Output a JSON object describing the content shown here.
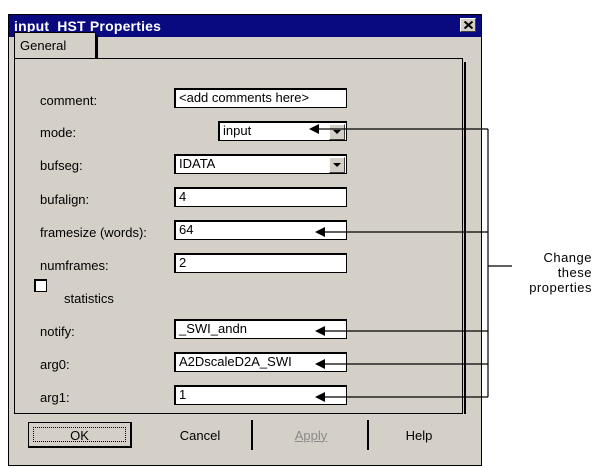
{
  "dialog": {
    "title": "input_HST Properties",
    "tab": "General"
  },
  "fields": {
    "comment": {
      "label": "comment:",
      "value": "<add comments here>"
    },
    "mode": {
      "label": "mode:",
      "value": "input"
    },
    "bufseg": {
      "label": "bufseg:",
      "value": "IDATA"
    },
    "bufalign": {
      "label": "bufalign:",
      "value": "4"
    },
    "framesize": {
      "label": "framesize (words):",
      "value": "64"
    },
    "numframes": {
      "label": "numframes:",
      "value": "2"
    },
    "statistics": {
      "label": "statistics",
      "checked": false
    },
    "notify": {
      "label": "notify:",
      "value": "_SWI_andn"
    },
    "arg0": {
      "label": "arg0:",
      "value": "A2DscaleD2A_SWI"
    },
    "arg1": {
      "label": "arg1:",
      "value": "1"
    }
  },
  "buttons": {
    "ok": "OK",
    "cancel": "Cancel",
    "apply": "Apply",
    "help": "Help"
  },
  "callout": {
    "line1": "Change",
    "line2": "these",
    "line3": "properties"
  },
  "icons": {
    "close": "close-icon",
    "dropdown": "chevron-down-icon",
    "arrow": "arrow-left-icon"
  }
}
